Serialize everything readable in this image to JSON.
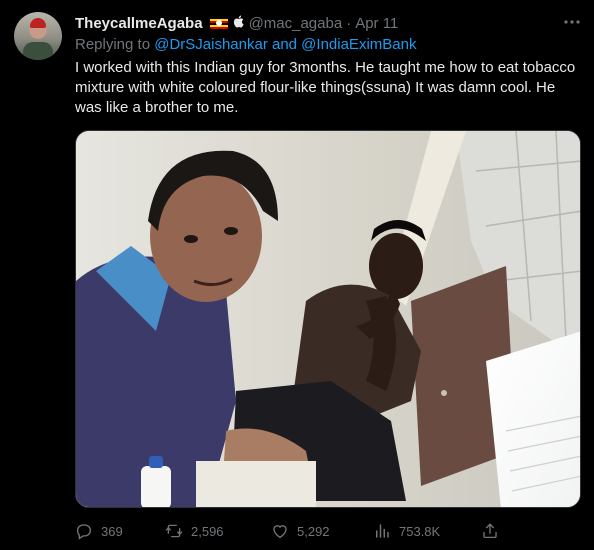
{
  "tweet": {
    "display_name": "TheycallmeAgaba",
    "flag_icon": "uganda-flag-icon",
    "apple_icon": "apple-logo-icon",
    "handle": "@mac_agaba",
    "separator": "·",
    "date": "Apr 11",
    "replying_prefix": "Replying to",
    "replying_to": "@DrSJaishankar and @IndiaEximBank",
    "text": "I worked with this Indian guy for 3months. He taught me how to eat tobacco mixture with white coloured flour-like things(ssuna) It was damn cool. He was like a brother to me."
  },
  "actions": {
    "replies": "369",
    "retweets": "2,596",
    "likes": "5,292",
    "views": "753.8K"
  },
  "colors": {
    "background": "#000000",
    "text": "#e7e9ea",
    "muted": "#71767b",
    "link": "#1d9bf0"
  }
}
